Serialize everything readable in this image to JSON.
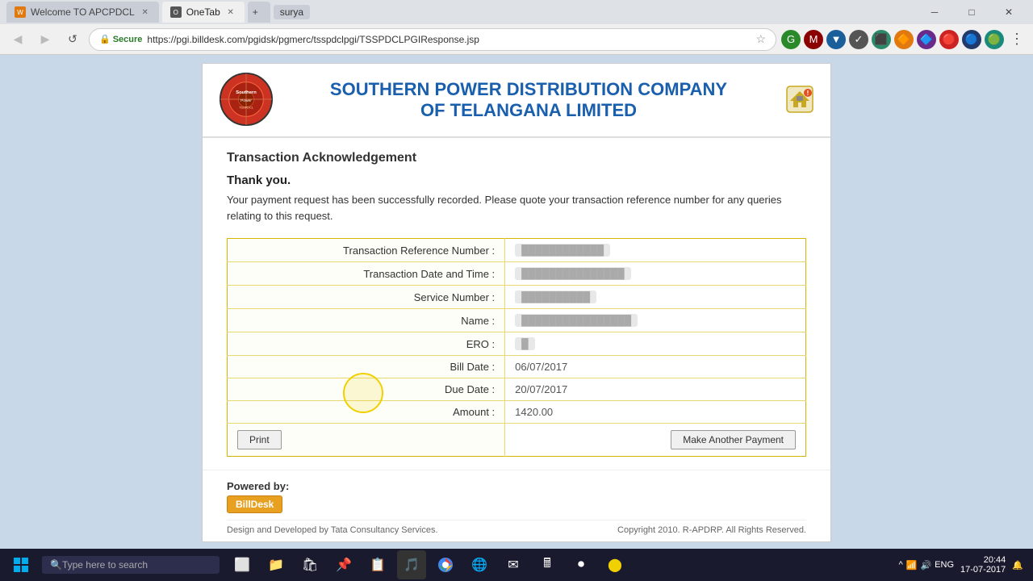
{
  "browser": {
    "user": "surya",
    "tabs": [
      {
        "label": "Welcome TO APCPDCL",
        "active": false,
        "favicon": "W"
      },
      {
        "label": "OneTab",
        "active": true,
        "favicon": "O"
      }
    ],
    "url": "https://pgi.billdesk.com/pgidsk/pgmerc/tsspdclpgi/TSSPDCLPGIResponse.jsp",
    "secure_label": "Secure",
    "win_controls": [
      "─",
      "□",
      "✕"
    ],
    "new_tab_label": "+"
  },
  "nav": {
    "back_arrow": "◀",
    "forward_arrow": "▶",
    "refresh": "↺",
    "star": "☆"
  },
  "page": {
    "company": {
      "name_line1": "SOUTHERN POWER DISTRIBUTION COMPANY",
      "name_line2": "OF TELANGANA LIMITED",
      "logo_text": "Southern\nPower"
    },
    "title": "Transaction Acknowledgement",
    "thank_you": "Thank you.",
    "success_message": "Your payment request has been successfully recorded. Please quote your transaction reference number for any queries relating to this request.",
    "table": {
      "rows": [
        {
          "label": "Transaction Reference Number :",
          "value": "████████████",
          "blurred": true
        },
        {
          "label": "Transaction Date and Time :",
          "value": "███████████████",
          "blurred": true
        },
        {
          "label": "Service Number :",
          "value": "██████████",
          "blurred": true
        },
        {
          "label": "Name :",
          "value": "████████████████",
          "blurred": true
        },
        {
          "label": "ERO :",
          "value": "█",
          "blurred": true
        },
        {
          "label": "Bill Date :",
          "value": "06/07/2017",
          "blurred": false
        },
        {
          "label": "Due Date :",
          "value": "20/07/2017",
          "blurred": false
        },
        {
          "label": "Amount :",
          "value": "1420.00",
          "blurred": false
        }
      ]
    },
    "buttons": {
      "print": "Print",
      "make_payment": "Make Another Payment"
    },
    "footer": {
      "powered_by": "Powered by:",
      "billdesk": "BillDesk",
      "credits": "Design and Developed by Tata Consultancy Services.",
      "copyright": "Copyright 2010. R-APDRP. All Rights Reserved."
    }
  },
  "taskbar": {
    "search_placeholder": "Type here to search",
    "time": "20:44",
    "date": "17-07-2017",
    "language": "ENG"
  }
}
